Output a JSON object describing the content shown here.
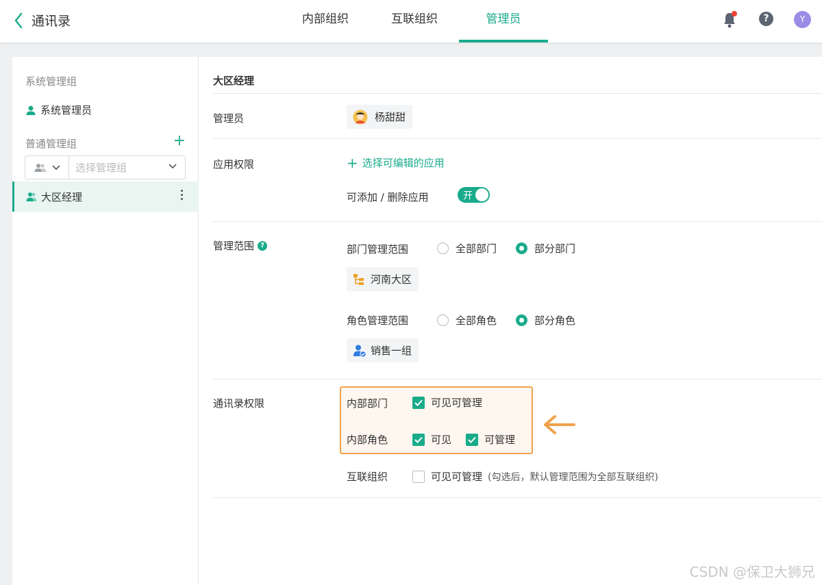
{
  "header": {
    "title": "通讯录",
    "tabs": [
      {
        "label": "内部组织"
      },
      {
        "label": "互联组织"
      },
      {
        "label": "管理员"
      }
    ],
    "active_tab": "管理员",
    "avatar_letter": "Y",
    "accent_color": "#1aab8b",
    "notification_dot_color": "#f04134"
  },
  "sidebar": {
    "system_group_heading": "系统管理组",
    "system_admin_item": "系统管理员",
    "normal_group_heading": "普通管理组",
    "add_label": "+",
    "group_select_placeholder": "选择管理组",
    "active_item": "大区经理"
  },
  "panel": {
    "title": "大区经理",
    "admin": {
      "label": "管理员",
      "user_name": "杨甜甜"
    },
    "app_permission": {
      "label": "应用权限",
      "select_link": "选择可编辑的应用",
      "add_remove_label": "可添加 / 删除应用",
      "toggle_text": "开",
      "toggle_on": true
    },
    "scope": {
      "label": "管理范围",
      "help_icon": "?",
      "dept_scope_label": "部门管理范围",
      "dept_options": [
        "全部部门",
        "部分部门"
      ],
      "dept_selected": "部分部门",
      "dept_chip": "河南大区",
      "role_scope_label": "角色管理范围",
      "role_options": [
        "全部角色",
        "部分角色"
      ],
      "role_selected": "部分角色",
      "role_chip": "销售一组"
    },
    "contacts_permission": {
      "label": "通讯录权限",
      "internal_dept_label": "内部部门",
      "internal_dept_option": "可见可管理",
      "internal_dept_checked": true,
      "internal_role_label": "内部角色",
      "internal_role_options": [
        "可见",
        "可管理"
      ],
      "internal_role_checked": [
        true,
        true
      ],
      "linked_org_label": "互联组织",
      "linked_org_option": "可见可管理",
      "linked_org_note": "(勾选后，默认管理范围为全部互联组织)",
      "linked_org_checked": false
    }
  },
  "watermark": "CSDN @保卫大狮兄"
}
